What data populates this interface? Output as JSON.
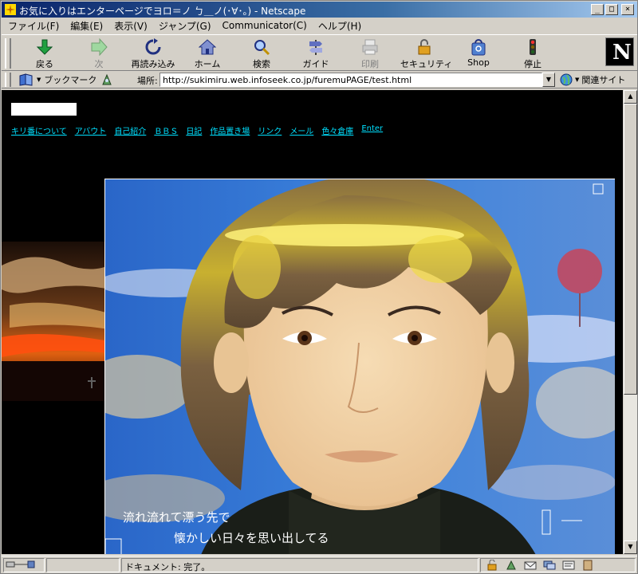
{
  "window": {
    "title": "お気に入りはエンターページでヨロ＝ノ ㄅ＿ノ(･∀･｡) - Netscape"
  },
  "title_buttons": {
    "minimize": "_",
    "maximize": "□",
    "close": "×"
  },
  "menu": [
    "ファイル(F)",
    "編集(E)",
    "表示(V)",
    "ジャンプ(G)",
    "Communicator(C)",
    "ヘルプ(H)"
  ],
  "toolbar": {
    "back": "戻る",
    "forward": "次",
    "reload": "再読み込み",
    "home": "ホーム",
    "search": "検索",
    "guide": "ガイド",
    "print": "印刷",
    "security": "セキュリティ",
    "shop": "Shop",
    "stop": "停止"
  },
  "netscape_logo": "N",
  "location": {
    "bookmarks_label": "ブックマーク",
    "location_label": "場所:",
    "url": "http://sukimiru.web.infoseek.co.jp/furemuPAGE/test.html",
    "related_label": "関連サイト"
  },
  "page": {
    "nav": [
      "キリ番について",
      "アバウト",
      "自己紹介",
      "ＢＢＳ",
      "日記",
      "作品置き場",
      "リンク",
      "メール",
      "色々倉庫",
      "Enter"
    ],
    "poem_line1": "流れ流れて漂う先で",
    "poem_line2": "懐かしい日々を思い出してる"
  },
  "status": {
    "text": "ドキュメント: 完了。"
  },
  "colors": {
    "content_bg": "#000000",
    "link": "#00e0ff",
    "titlebar_start": "#0a246a",
    "titlebar_end": "#a6caf0"
  }
}
